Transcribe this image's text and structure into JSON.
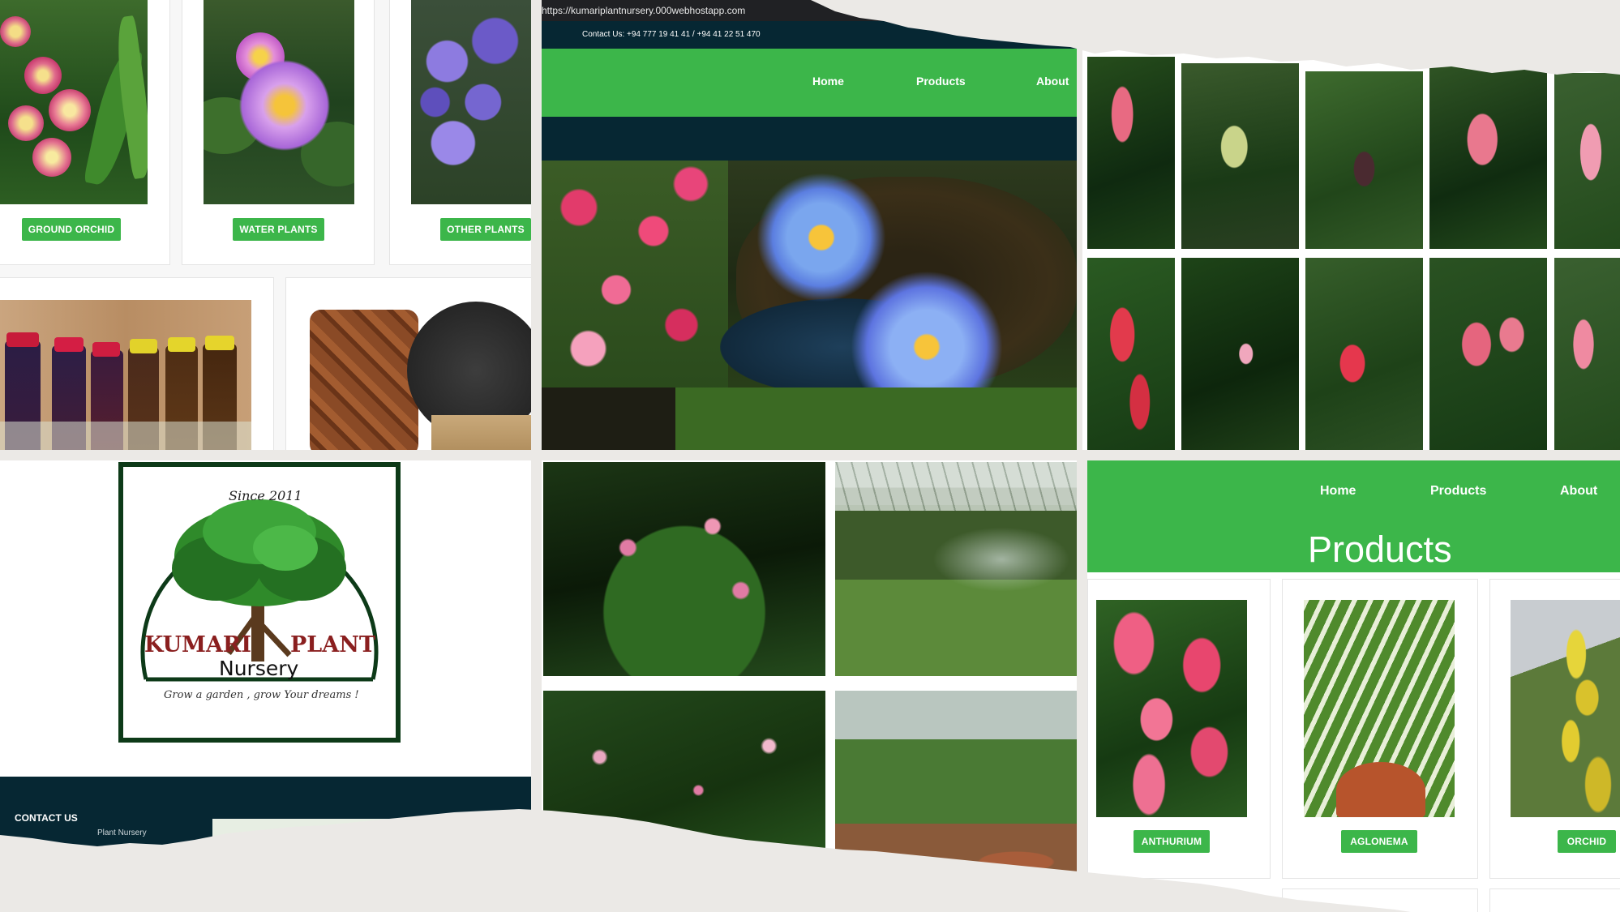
{
  "browser": {
    "url": "https://kumariplantnursery.000webhostapp.com"
  },
  "topbar": {
    "contact": "Contact Us: +94 777 19 41 41 / +94 41 22 51 470"
  },
  "nav": {
    "home": "Home",
    "products": "Products",
    "about": "About"
  },
  "categories_top": {
    "ground_orchid": "GROUND ORCHID",
    "water_plants": "WATER PLANTS",
    "other_plants": "OTHER PLANTS"
  },
  "logo": {
    "since": "Since 2011",
    "name_left": "KUMARI",
    "name_right": "PLANT",
    "subtitle": "Nursery",
    "tagline": "Grow a garden , grow Your dreams !"
  },
  "footer": {
    "contact_heading": "CONTACT US",
    "footer_line": "Plant Nursery"
  },
  "products_page": {
    "title": "Products",
    "items": {
      "anthurium": "ANTHURIUM",
      "aglonema": "AGLONEMA",
      "orchid": "ORCHID"
    }
  },
  "colors": {
    "accent_green": "#3cb64a",
    "dark_navy": "#062733",
    "paper_tear": "#ebe9e6"
  }
}
